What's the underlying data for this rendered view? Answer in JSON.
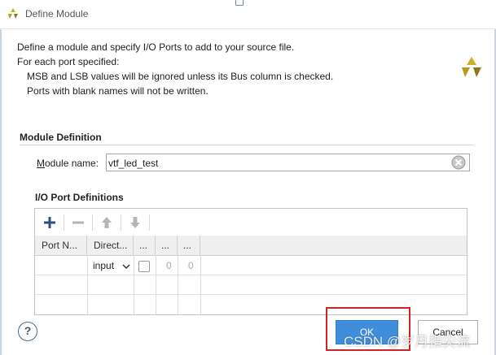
{
  "dialog": {
    "title": "Define Module"
  },
  "background": {
    "tab_fragment": ""
  },
  "description": {
    "line1": "Define a module and specify I/O Ports to add to your source file.",
    "line2": "For each port specified:",
    "line3": "MSB and LSB values will be ignored unless its Bus column is checked.",
    "line4": "Ports with blank names will not be written."
  },
  "module_definition": {
    "title": "Module Definition",
    "name_label_prefix": "M",
    "name_label_rest": "odule name:",
    "name_value": "vtf_led_test"
  },
  "io_ports": {
    "title": "I/O Port Definitions",
    "toolbar": [
      "add-icon",
      "remove-icon",
      "move-up-icon",
      "move-down-icon"
    ],
    "columns": [
      "Port N...",
      "Direct...",
      "...",
      "...",
      "..."
    ],
    "rows": [
      {
        "name": "",
        "direction": "input",
        "bus": false,
        "msb": "0",
        "lsb": "0"
      }
    ]
  },
  "buttons": {
    "help": "?",
    "ok": "OK",
    "cancel": "Cancel"
  },
  "watermark": "CSDN @岁月指尖流",
  "colors": {
    "accent": "#3e8edc",
    "highlight": "#d32222",
    "logo": "#c7b02c"
  }
}
